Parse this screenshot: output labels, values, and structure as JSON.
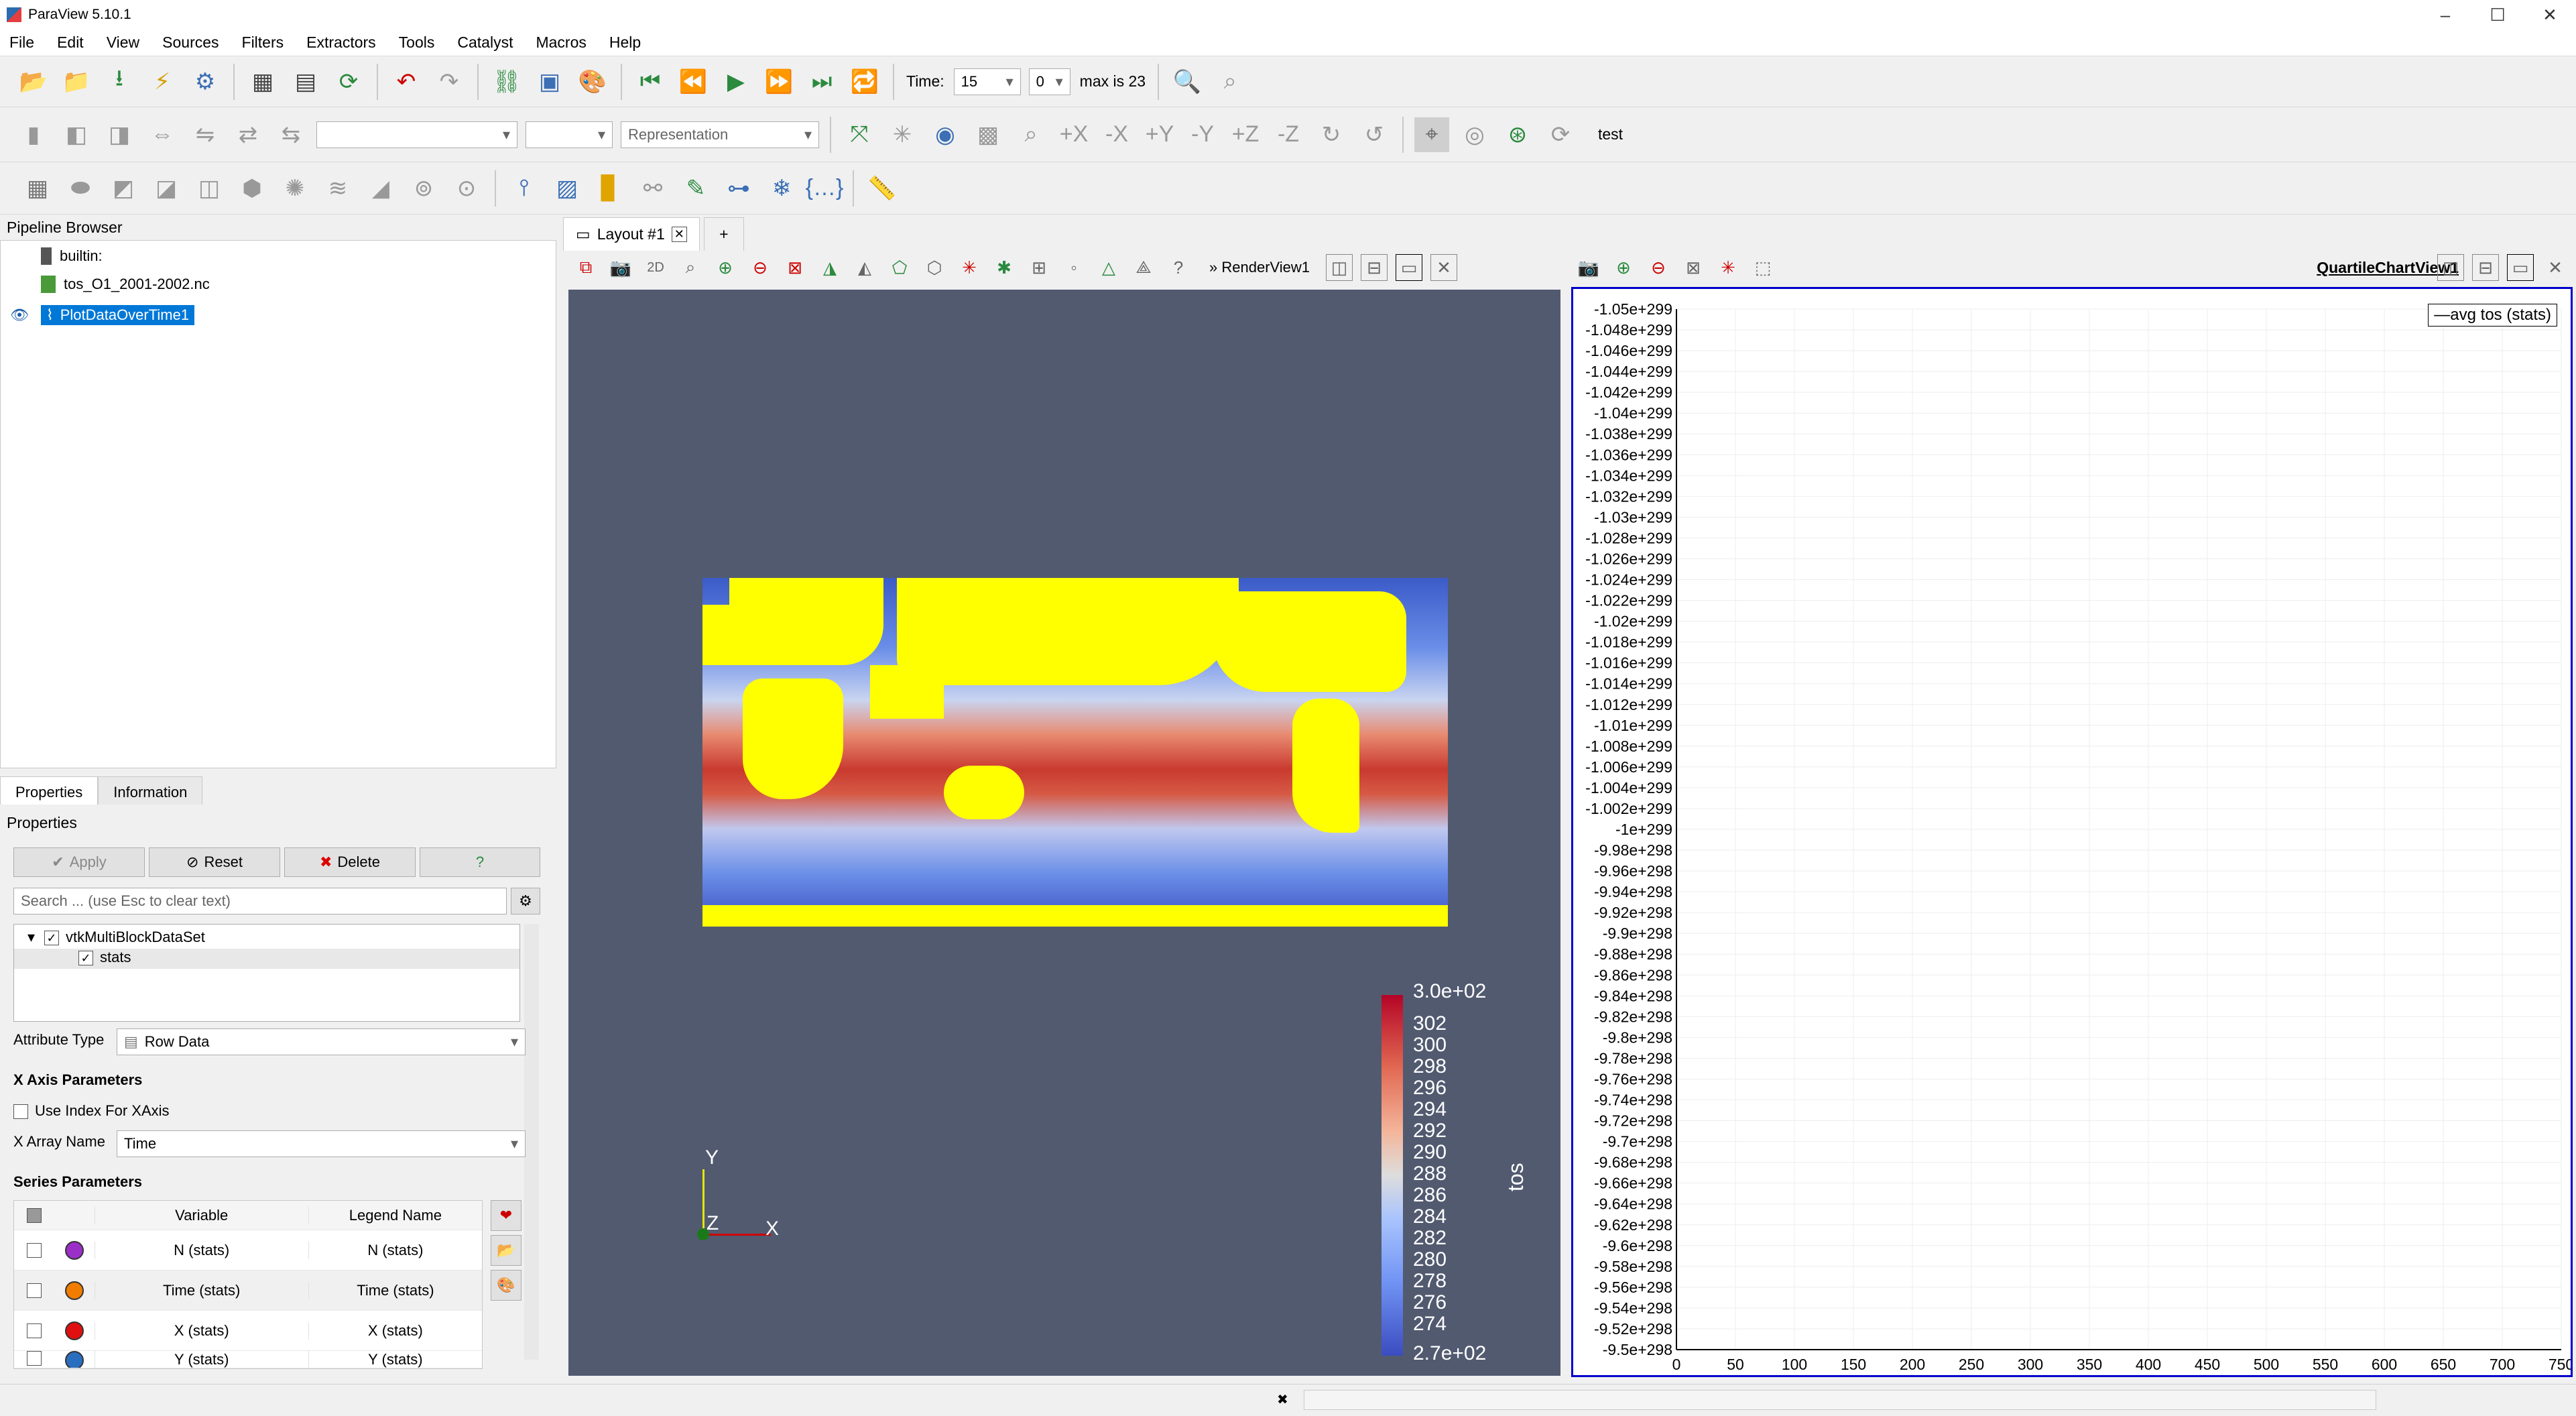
{
  "window": {
    "title": "ParaView 5.10.1"
  },
  "menu": [
    "File",
    "Edit",
    "View",
    "Sources",
    "Filters",
    "Extractors",
    "Tools",
    "Catalyst",
    "Macros",
    "Help"
  ],
  "toolbar": {
    "time_label": "Time:",
    "time_value": "15",
    "time_index": "0",
    "max_label": "max is 23",
    "representation_placeholder": "Representation",
    "test_label": "test"
  },
  "pipeline": {
    "title": "Pipeline Browser",
    "items": [
      "builtin:",
      "tos_O1_2001-2002.nc",
      "PlotDataOverTime1"
    ]
  },
  "panel_tabs": [
    "Properties",
    "Information"
  ],
  "properties": {
    "title": "Properties",
    "apply": "Apply",
    "reset": "Reset",
    "delete": "Delete",
    "help": "?",
    "search_placeholder": "Search ... (use Esc to clear text)",
    "tree": [
      "vtkMultiBlockDataSet",
      "stats"
    ],
    "attribute_type_label": "Attribute Type",
    "attribute_type_value": "Row Data",
    "x_axis_section": "X Axis Parameters",
    "use_index_label": "Use Index For XAxis",
    "x_array_label": "X Array Name",
    "x_array_value": "Time",
    "series_section": "Series Parameters",
    "series_headers": {
      "variable": "Variable",
      "legend": "Legend Name"
    },
    "series": [
      {
        "variable": "N (stats)",
        "legend": "N (stats)",
        "color": "#9b30c8"
      },
      {
        "variable": "Time (stats)",
        "legend": "Time (stats)",
        "color": "#f07c00"
      },
      {
        "variable": "X (stats)",
        "legend": "X (stats)",
        "color": "#e01010"
      },
      {
        "variable": "Y (stats)",
        "legend": "Y (stats)",
        "color": "#2a6fbf"
      }
    ]
  },
  "layout": {
    "tab": "Layout #1",
    "plus": "+",
    "render_view_label": "RenderView1",
    "twod": "2D",
    "chart_view_label": "QuartileChartView1"
  },
  "colorbar": {
    "title": "tos",
    "labels": [
      "3.0e+02",
      "302",
      "300",
      "298",
      "296",
      "294",
      "292",
      "290",
      "288",
      "286",
      "284",
      "282",
      "280",
      "278",
      "276",
      "274",
      "2.7e+02"
    ]
  },
  "orientation_axes": {
    "x": "X",
    "y": "Y",
    "z": "Z"
  },
  "chart_data": {
    "type": "line",
    "legend": [
      "avg tos (stats)"
    ],
    "y_ticks": [
      "-1.05e+299",
      "-1.048e+299",
      "-1.046e+299",
      "-1.044e+299",
      "-1.042e+299",
      "-1.04e+299",
      "-1.038e+299",
      "-1.036e+299",
      "-1.034e+299",
      "-1.032e+299",
      "-1.03e+299",
      "-1.028e+299",
      "-1.026e+299",
      "-1.024e+299",
      "-1.022e+299",
      "-1.02e+299",
      "-1.018e+299",
      "-1.016e+299",
      "-1.014e+299",
      "-1.012e+299",
      "-1.01e+299",
      "-1.008e+299",
      "-1.006e+299",
      "-1.004e+299",
      "-1.002e+299",
      "-1e+299",
      "-9.98e+298",
      "-9.96e+298",
      "-9.94e+298",
      "-9.92e+298",
      "-9.9e+298",
      "-9.88e+298",
      "-9.86e+298",
      "-9.84e+298",
      "-9.82e+298",
      "-9.8e+298",
      "-9.78e+298",
      "-9.76e+298",
      "-9.74e+298",
      "-9.72e+298",
      "-9.7e+298",
      "-9.68e+298",
      "-9.66e+298",
      "-9.64e+298",
      "-9.62e+298",
      "-9.6e+298",
      "-9.58e+298",
      "-9.56e+298",
      "-9.54e+298",
      "-9.52e+298",
      "-9.5e+298"
    ],
    "x_ticks": [
      "0",
      "50",
      "100",
      "150",
      "200",
      "250",
      "300",
      "350",
      "400",
      "450",
      "500",
      "550",
      "600",
      "650",
      "700",
      "750"
    ],
    "xlim": [
      0,
      750
    ],
    "ylim": [
      -1.05e+299,
      -9.5e+298
    ],
    "grid": true,
    "legend_position": "top-right",
    "series": []
  }
}
